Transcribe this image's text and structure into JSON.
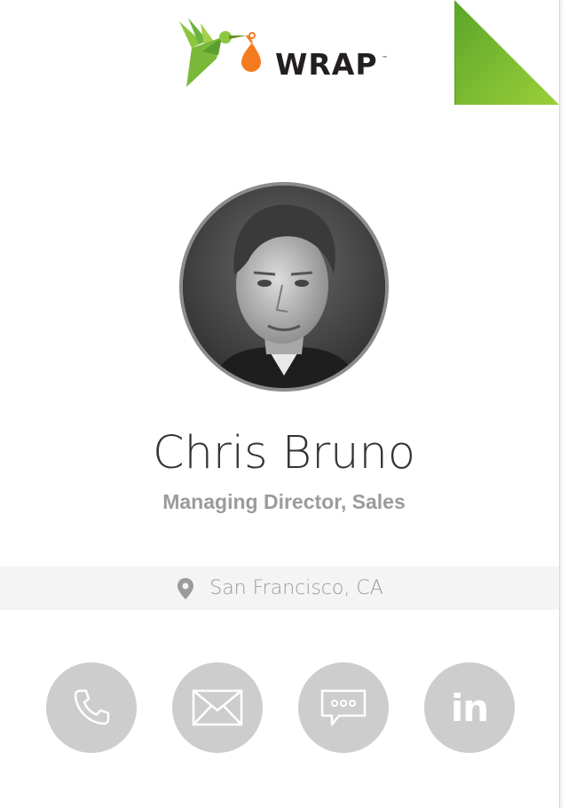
{
  "brand": {
    "logo_text": "WRAP",
    "trademark": "™",
    "logo_icon": "hummingbird-icon",
    "accent_green": "#8cc63f",
    "accent_orange": "#f47b20"
  },
  "corner_fold": {
    "icon": "page-curl-icon",
    "color": "#7fbf2e"
  },
  "profile": {
    "photo_icon": "profile-photo",
    "name": "Chris Bruno",
    "title": "Managing Director, Sales"
  },
  "location": {
    "icon": "map-pin-icon",
    "text": "San Francisco, CA"
  },
  "actions": [
    {
      "id": "phone",
      "icon": "phone-icon"
    },
    {
      "id": "email",
      "icon": "envelope-icon"
    },
    {
      "id": "message",
      "icon": "chat-bubble-icon"
    },
    {
      "id": "linkedin",
      "icon": "linkedin-icon",
      "glyph": "in"
    }
  ],
  "colors": {
    "action_bg": "#cdcdcd",
    "muted_text": "#9b9b9b",
    "name_text": "#333333",
    "location_bg": "#f4f4f4"
  }
}
